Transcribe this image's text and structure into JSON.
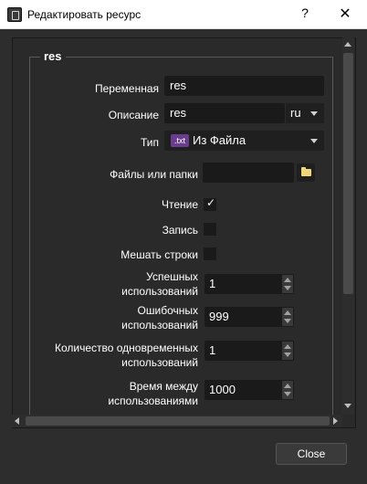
{
  "window": {
    "title": "Редактировать ресурс",
    "help_icon": "?",
    "close_icon": "✕"
  },
  "group": {
    "title": "res"
  },
  "form": {
    "variable_label": "Переменная",
    "variable_value": "res",
    "description_label": "Описание",
    "description_value": "res",
    "language_value": "ru",
    "type_label": "Тип",
    "type_badge": ".txt",
    "type_value": "Из Файла",
    "files_label": "Файлы или папки",
    "files_value": "",
    "read_label": "Чтение",
    "read_checked": true,
    "read_check_glyph": "✓",
    "write_label": "Запись",
    "write_checked": false,
    "shuffle_label": "Мешать строки",
    "shuffle_checked": false,
    "success_label_line1": "Успешных",
    "success_label_line2": "использований",
    "success_value": "1",
    "error_label_line1": "Ошибочных",
    "error_label_line2": "использований",
    "error_value": "999",
    "concurrent_label_line1": "Количество одновременных",
    "concurrent_label_line2": "использований",
    "concurrent_value": "1",
    "interval_label_line1": "Время между",
    "interval_label_line2": "использованиями",
    "interval_value": "1000"
  },
  "footer": {
    "close_label": "Close"
  },
  "colors": {
    "background": "#2d2d2d",
    "field": "#1a1a1a",
    "badge": "#6a3d8e",
    "folder": "#f0d57a"
  }
}
